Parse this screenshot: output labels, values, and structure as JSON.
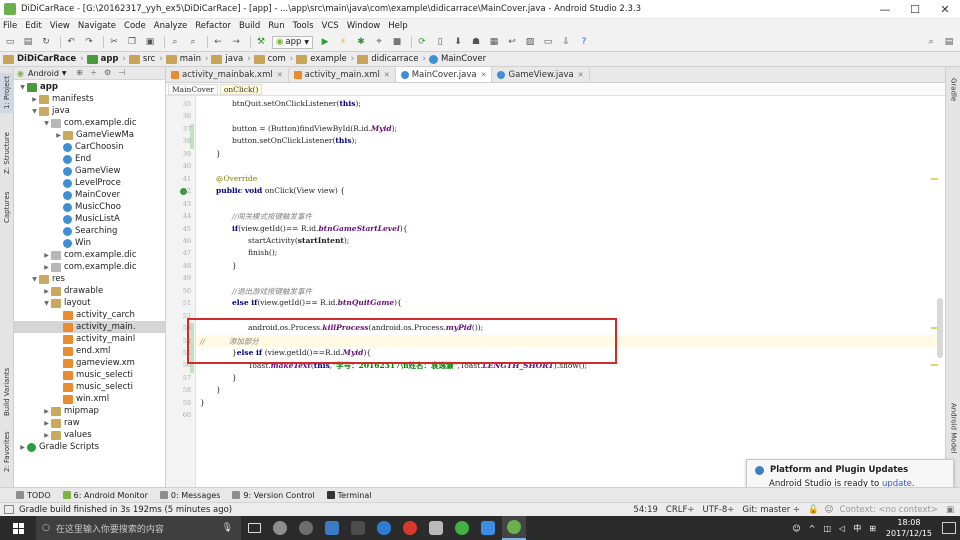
{
  "window": {
    "title": "DiDiCarRace - [G:\\20162317_yyh_ex5\\DiDiCarRace] - [app] - ...\\app\\src\\main\\java\\com\\example\\didicarrace\\MainCover.java - Android Studio 2.3.3",
    "minimize": "—",
    "maximize": "☐",
    "close": "✕"
  },
  "menu": [
    "File",
    "Edit",
    "View",
    "Navigate",
    "Code",
    "Analyze",
    "Refactor",
    "Build",
    "Run",
    "Tools",
    "VCS",
    "Window",
    "Help"
  ],
  "toolbar": {
    "run_config": "app"
  },
  "breadcrumbs": [
    "DiDiCarRace",
    "app",
    "src",
    "main",
    "java",
    "com",
    "example",
    "didicarrace",
    "MainCover"
  ],
  "project_panel": {
    "view_mode": "Android",
    "tree": [
      {
        "label": "app",
        "icon": "module",
        "arrow": "▼",
        "bold": true
      },
      {
        "label": "manifests",
        "icon": "folder",
        "arrow": "▶"
      },
      {
        "label": "java",
        "icon": "folder",
        "arrow": "▼"
      },
      {
        "label": "com.example.dic",
        "icon": "package",
        "arrow": "▼"
      },
      {
        "label": "GameViewMa",
        "icon": "folder",
        "arrow": "▶"
      },
      {
        "label": "CarChoosin",
        "icon": "class",
        "arrow": ""
      },
      {
        "label": "End",
        "icon": "class",
        "arrow": ""
      },
      {
        "label": "GameView",
        "icon": "class",
        "arrow": ""
      },
      {
        "label": "LevelProce",
        "icon": "class",
        "arrow": ""
      },
      {
        "label": "MainCover",
        "icon": "class",
        "arrow": ""
      },
      {
        "label": "MusicChoo",
        "icon": "class",
        "arrow": ""
      },
      {
        "label": "MusicListA",
        "icon": "class",
        "arrow": ""
      },
      {
        "label": "Searching",
        "icon": "class",
        "arrow": ""
      },
      {
        "label": "Win",
        "icon": "class",
        "arrow": ""
      },
      {
        "label": "com.example.dic",
        "icon": "package",
        "arrow": "▶"
      },
      {
        "label": "com.example.dic",
        "icon": "package",
        "arrow": "▶"
      },
      {
        "label": "res",
        "icon": "folder",
        "arrow": "▼"
      },
      {
        "label": "drawable",
        "icon": "folder",
        "arrow": "▶"
      },
      {
        "label": "layout",
        "icon": "folder",
        "arrow": "▼"
      },
      {
        "label": "activity_carch",
        "icon": "xml",
        "arrow": ""
      },
      {
        "label": "activity_main.",
        "icon": "xml",
        "arrow": "",
        "selected": true
      },
      {
        "label": "activity_mainl",
        "icon": "xml",
        "arrow": ""
      },
      {
        "label": "end.xml",
        "icon": "xml",
        "arrow": ""
      },
      {
        "label": "gameview.xm",
        "icon": "xml",
        "arrow": ""
      },
      {
        "label": "music_selecti",
        "icon": "xml",
        "arrow": ""
      },
      {
        "label": "music_selecti",
        "icon": "xml",
        "arrow": ""
      },
      {
        "label": "win.xml",
        "icon": "xml",
        "arrow": ""
      },
      {
        "label": "mipmap",
        "icon": "folder",
        "arrow": "▶"
      },
      {
        "label": "raw",
        "icon": "folder",
        "arrow": "▶"
      },
      {
        "label": "values",
        "icon": "folder",
        "arrow": "▶"
      },
      {
        "label": "Gradle Scripts",
        "icon": "gradle",
        "arrow": "▶"
      }
    ]
  },
  "left_tool_tabs": [
    "1: Project",
    "Z: Structure",
    "Captures",
    "Build Variants",
    "2: Favorites"
  ],
  "right_tool_tabs": [
    "Gradle",
    "Android Model"
  ],
  "editor_tabs": [
    {
      "label": "activity_mainbak.xml",
      "active": false
    },
    {
      "label": "activity_main.xml",
      "active": false
    },
    {
      "label": "MainCover.java",
      "active": true
    },
    {
      "label": "GameView.java",
      "active": false
    }
  ],
  "code_breadcrumb": [
    "MainCover",
    "onClick()"
  ],
  "line_numbers": [
    "35",
    "36",
    "37",
    "38",
    "39",
    "40",
    "41",
    "42",
    "43",
    "44",
    "45",
    "46",
    "47",
    "48",
    "49",
    "50",
    "51",
    "52",
    "53",
    "54",
    "55",
    "56",
    "57",
    "58",
    "59",
    "60"
  ],
  "code_lines": [
    {
      "indent": 2,
      "parts": [
        {
          "t": "btnQuit.setOnClickListener(",
          "c": ""
        },
        {
          "t": "this",
          "c": "kw"
        },
        {
          "t": ");",
          "c": ""
        }
      ]
    },
    {
      "indent": 0,
      "parts": []
    },
    {
      "indent": 2,
      "parts": [
        {
          "t": "button = (Button)findViewById(R.id.",
          "c": ""
        },
        {
          "t": "Myid",
          "c": "fld"
        },
        {
          "t": ");",
          "c": ""
        }
      ]
    },
    {
      "indent": 2,
      "parts": [
        {
          "t": "button.setOnClickListener(",
          "c": ""
        },
        {
          "t": "this",
          "c": "kw"
        },
        {
          "t": ");",
          "c": ""
        }
      ]
    },
    {
      "indent": 1,
      "parts": [
        {
          "t": "}",
          "c": ""
        }
      ]
    },
    {
      "indent": 0,
      "parts": []
    },
    {
      "indent": 1,
      "parts": [
        {
          "t": "@Override",
          "c": "an"
        }
      ]
    },
    {
      "indent": 1,
      "parts": [
        {
          "t": "public void ",
          "c": "kw"
        },
        {
          "t": "onClick(View view) {",
          "c": ""
        }
      ]
    },
    {
      "indent": 0,
      "parts": []
    },
    {
      "indent": 2,
      "parts": [
        {
          "t": "//闯关模式按键触发事件",
          "c": "cm"
        }
      ]
    },
    {
      "indent": 2,
      "parts": [
        {
          "t": "if",
          "c": "kw"
        },
        {
          "t": "(view.getId()== R.id.",
          "c": ""
        },
        {
          "t": "btnGameStartLevel",
          "c": "fld"
        },
        {
          "t": "){",
          "c": ""
        }
      ]
    },
    {
      "indent": 3,
      "parts": [
        {
          "t": "startActivity(",
          "c": ""
        },
        {
          "t": "startIntent",
          "c": "bold"
        },
        {
          "t": ");",
          "c": ""
        }
      ]
    },
    {
      "indent": 3,
      "parts": [
        {
          "t": "finish();",
          "c": ""
        }
      ]
    },
    {
      "indent": 2,
      "parts": [
        {
          "t": "}",
          "c": ""
        }
      ]
    },
    {
      "indent": 0,
      "parts": []
    },
    {
      "indent": 2,
      "parts": [
        {
          "t": "//退出游戏按键触发事件",
          "c": "cm"
        }
      ]
    },
    {
      "indent": 2,
      "parts": [
        {
          "t": "else if",
          "c": "kw"
        },
        {
          "t": "(view.getId()== R.id.",
          "c": ""
        },
        {
          "t": "btnQuitGame",
          "c": "fld"
        },
        {
          "t": "){",
          "c": ""
        }
      ]
    },
    {
      "indent": 0,
      "parts": []
    },
    {
      "indent": 3,
      "parts": [
        {
          "t": "android.os.Process.",
          "c": ""
        },
        {
          "t": "killProcess",
          "c": "fld"
        },
        {
          "t": "(android.os.Process.",
          "c": ""
        },
        {
          "t": "myPid",
          "c": "fld"
        },
        {
          "t": "());",
          "c": ""
        }
      ]
    },
    {
      "indent": 0,
      "parts": [
        {
          "t": "//          添加部分",
          "c": "cm"
        }
      ]
    },
    {
      "indent": 2,
      "parts": [
        {
          "t": "}",
          "c": ""
        },
        {
          "t": "else if ",
          "c": "kw"
        },
        {
          "t": "(view.getId()==R.id.",
          "c": ""
        },
        {
          "t": "Myid",
          "c": "fld"
        },
        {
          "t": "){",
          "c": ""
        }
      ]
    },
    {
      "indent": 3,
      "parts": [
        {
          "t": "Toast.",
          "c": ""
        },
        {
          "t": "makeText",
          "c": "fld"
        },
        {
          "t": "(",
          "c": ""
        },
        {
          "t": "this",
          "c": "kw"
        },
        {
          "t": ",",
          "c": ""
        },
        {
          "t": "\"学号：20162317\\n姓名：袁逸灏\"",
          "c": "st"
        },
        {
          "t": ",Toast.",
          "c": ""
        },
        {
          "t": "LENGTH_SHORT",
          "c": "fld"
        },
        {
          "t": ").show();",
          "c": ""
        }
      ]
    },
    {
      "indent": 2,
      "parts": [
        {
          "t": "}",
          "c": ""
        }
      ]
    },
    {
      "indent": 1,
      "parts": [
        {
          "t": "}",
          "c": ""
        }
      ]
    },
    {
      "indent": 0,
      "parts": [
        {
          "t": "}",
          "c": ""
        }
      ]
    },
    {
      "indent": 0,
      "parts": []
    }
  ],
  "notification": {
    "title": "Platform and Plugin Updates",
    "body": "Android Studio is ready to ",
    "link": "update",
    "tail": "."
  },
  "bottom_tabs": [
    "TODO",
    "6: Android Monitor",
    "0: Messages",
    "9: Version Control",
    "Terminal"
  ],
  "status": {
    "message": "Gradle build finished in 3s 192ms (5 minutes ago)",
    "position": "54:19",
    "line_sep": "CRLF÷",
    "encoding": "UTF-8÷",
    "git": "Git: master ÷",
    "context": "Context: <no context>"
  },
  "taskbar": {
    "search_placeholder": "在这里输入你要搜索的内容",
    "ime": "中",
    "time": "18:08",
    "date": "2017/12/15"
  },
  "colors": {
    "redbox": "#d12a2a",
    "keyword": "#000080",
    "string": "#008000",
    "field": "#660e7a",
    "comment": "#808080"
  }
}
